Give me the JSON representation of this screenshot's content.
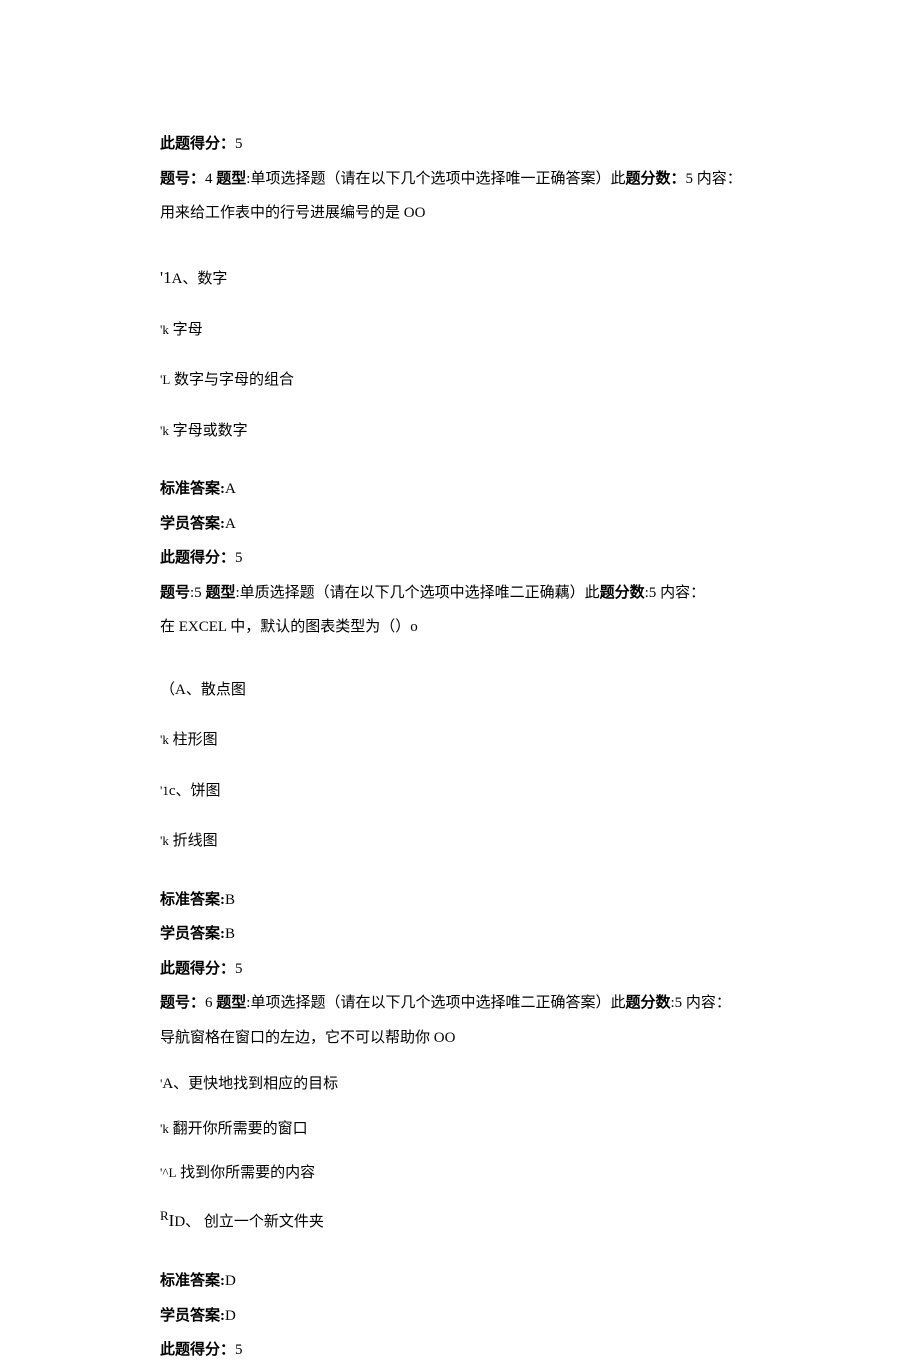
{
  "q3": {
    "score_label": "此题得分：",
    "score": "5"
  },
  "q4": {
    "header_num_label": "题号：",
    "header_num": "4",
    "header_type_label": "题型",
    "header_type": ":单项选择题（请在以下几个选项中选择唯一正确答案）此",
    "header_score_label": "题分数：",
    "header_score": "5",
    "header_content_label": "内容：",
    "body": "用来给工作表中的行号进展编号的是 OO",
    "optA_prefix": "'1",
    "optA": "A、数字",
    "optB_prefix": "'k",
    "optB": "字母",
    "optC_prefix": "'L",
    "optC": "数字与字母的组合",
    "optD_prefix": "'k",
    "optD": "字母或数字",
    "std_ans_label": "标准答案:",
    "std_ans": "A",
    "stu_ans_label": "学员答案:",
    "stu_ans": "A",
    "score_label": "此题得分：",
    "score": "5"
  },
  "q5": {
    "header_num_label": "题号",
    "header_num": ":5",
    "header_type_label": "题型",
    "header_type": ":单质选择题（请在以下几个选项中选择唯二正确藕）此",
    "header_score_label": "题分数",
    "header_score": ":5",
    "header_content_label": "内容：",
    "body": "在 EXCEL 中，默认的图表类型为（）o",
    "optA_prefix": "（",
    "optA": "A、散点图",
    "optB_prefix": "'k",
    "optB": "柱形图",
    "optC_prefix": "'1",
    "optC": "c、饼图",
    "optD_prefix": "'k",
    "optD": "折线图",
    "std_ans_label": "标准答案:",
    "std_ans": "B",
    "stu_ans_label": "学员答案:",
    "stu_ans": "B",
    "score_label": "此题得分：",
    "score": "5"
  },
  "q6": {
    "header_num_label": "题号：",
    "header_num": "6",
    "header_type_label": "题型",
    "header_type": ":单项选择题（请在以下几个选项中选择唯二正确答案）此",
    "header_score_label": "题分数",
    "header_score": ":5",
    "header_content_label": "内容：",
    "body": "导航窗格在窗口的左边，它不可以帮助你 OO",
    "optA_prefix": "'",
    "optA": "A、更快地找到相应的目标",
    "optB_prefix": "'k",
    "optB": "翻开你所需要的窗口",
    "optC_prefix": "'^L",
    "optC": "找到你所需要的内容",
    "optD_prefix_sup": "R",
    "optD_prefix": "I",
    "optD": "D、 创立一个新文件夹",
    "std_ans_label": "标准答案:",
    "std_ans": "D",
    "stu_ans_label": "学员答案:",
    "stu_ans": "D",
    "score_label": "此题得分：",
    "score": "5"
  }
}
